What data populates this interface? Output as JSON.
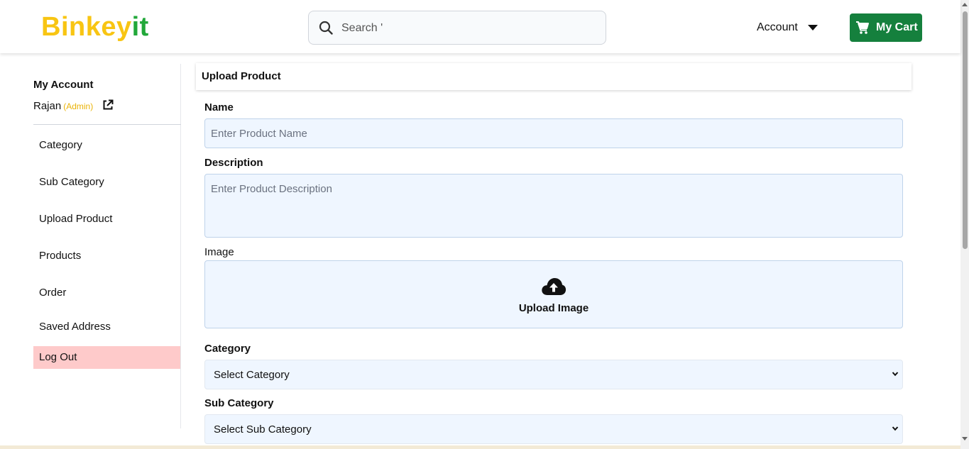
{
  "header": {
    "logo_part1": "Binkey",
    "logo_part2": "it",
    "search_placeholder": "Search '",
    "account_label": "Account",
    "cart_label": "My Cart"
  },
  "sidebar": {
    "title": "My Account",
    "user_name": "Rajan",
    "user_role": "(Admin)",
    "items": [
      {
        "label": "Category"
      },
      {
        "label": "Sub Category"
      },
      {
        "label": "Upload Product"
      },
      {
        "label": "Products"
      },
      {
        "label": "Order"
      },
      {
        "label": "Saved Address"
      },
      {
        "label": "Log Out"
      }
    ]
  },
  "main": {
    "title": "Upload Product",
    "name_label": "Name",
    "name_placeholder": "Enter Product Name",
    "description_label": "Description",
    "description_placeholder": "Enter Product Description",
    "image_label": "Image",
    "upload_label": "Upload Image",
    "category_label": "Category",
    "category_value": "Select Category",
    "subcategory_label": "Sub Category",
    "subcategory_value": "Select Sub Category"
  },
  "colors": {
    "logo_yellow": "#f8c513",
    "logo_green": "#22a83a",
    "cart_button": "#15803d",
    "field_bg": "#eff6ff",
    "logout_bg": "#fecaca",
    "admin_role": "#eab308"
  }
}
